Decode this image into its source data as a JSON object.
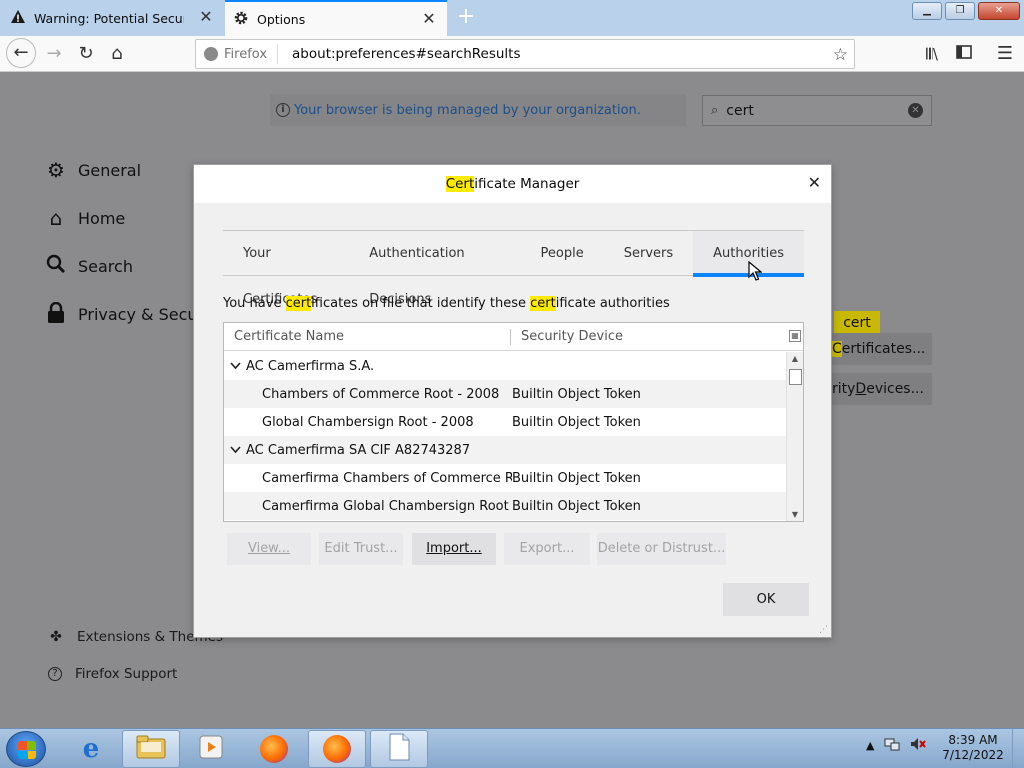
{
  "browser": {
    "tabs": [
      {
        "title": "Warning: Potential Security Risk"
      },
      {
        "title": "Options"
      }
    ],
    "url_identity": "Firefox",
    "url": "about:preferences#searchResults"
  },
  "prefs": {
    "managed_notice": "Your browser is being managed by your organization.",
    "search_value": "cert",
    "categories": [
      "General",
      "Home",
      "Search",
      "Privacy & Securi"
    ],
    "bottom_links": [
      "Extensions & Themes",
      "Firefox Support"
    ],
    "cert_tag": "cert",
    "view_certs_btn_hl": "C",
    "view_certs_btn_prefix": "",
    "view_certs_btn_rest": "ertificates...",
    "security_devices_btn": "rity Devices...",
    "security_devices_btn_hl_char": "D",
    "security_devices_btn_pre": "rity ",
    "security_devices_btn_post": "evices..."
  },
  "dialog": {
    "title_hl": "Cert",
    "title_rest": "ificate Manager",
    "tabs": [
      "Your Certificates",
      "Authentication Decisions",
      "People",
      "Servers",
      "Authorities"
    ],
    "selected_tab": "Authorities",
    "desc_parts": [
      "You have ",
      "cert",
      "ificates on file that identify these ",
      "cert",
      "ificate authorities"
    ],
    "columns": [
      "Certificate Name",
      "Security Device"
    ],
    "rows": [
      {
        "type": "group",
        "name": "AC Camerfirma S.A.",
        "device": ""
      },
      {
        "type": "child",
        "name": "Chambers of Commerce Root - 2008",
        "device": "Builtin Object Token"
      },
      {
        "type": "child",
        "name": "Global Chambersign Root - 2008",
        "device": "Builtin Object Token"
      },
      {
        "type": "group",
        "name": "AC Camerfirma SA CIF A82743287",
        "device": ""
      },
      {
        "type": "child",
        "name": "Camerfirma Chambers of Commerce Root",
        "device": "Builtin Object Token"
      },
      {
        "type": "child",
        "name": "Camerfirma Global Chambersign Root",
        "device": "Builtin Object Token"
      }
    ],
    "buttons": {
      "view": "View...",
      "edit_trust": "Edit Trust...",
      "import": "Import...",
      "export": "Export...",
      "delete": "Delete or Distrust...",
      "ok": "OK"
    }
  },
  "taskbar": {
    "time": "8:39 AM",
    "date": "7/12/2022"
  },
  "colors": {
    "accent": "#0a84ff",
    "highlight": "#ffeb00",
    "titlebar": "#b9d1ea"
  }
}
